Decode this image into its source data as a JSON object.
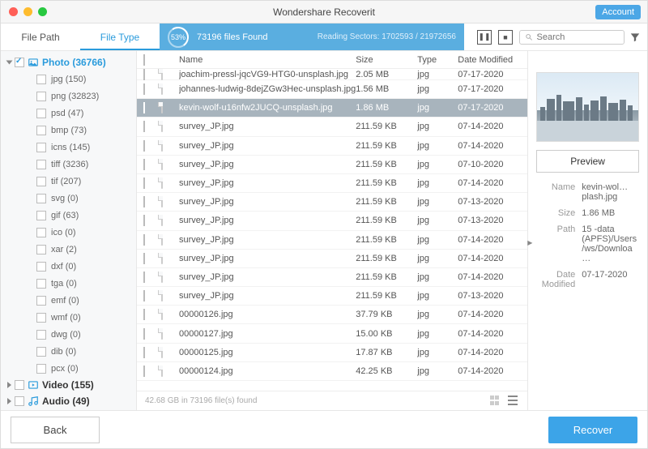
{
  "app": {
    "title": "Wondershare Recoverit",
    "account_label": "Account"
  },
  "viewTabs": {
    "filePath": "File Path",
    "fileType": "File Type"
  },
  "progress": {
    "percent": "53%",
    "found": "73196 files Found",
    "sectors": "Reading Sectors: 1702593 / 21972656"
  },
  "search": {
    "placeholder": "Search"
  },
  "sidebar": {
    "categories": [
      {
        "label": "Photo (36766)",
        "expanded": true,
        "checked": true,
        "active": true,
        "subs": [
          {
            "label": "jpg (150)"
          },
          {
            "label": "png (32823)"
          },
          {
            "label": "psd (47)"
          },
          {
            "label": "bmp (73)"
          },
          {
            "label": "icns (145)"
          },
          {
            "label": "tiff (3236)"
          },
          {
            "label": "tif (207)"
          },
          {
            "label": "svg (0)"
          },
          {
            "label": "gif (63)"
          },
          {
            "label": "ico (0)"
          },
          {
            "label": "xar (2)"
          },
          {
            "label": "dxf (0)"
          },
          {
            "label": "tga (0)"
          },
          {
            "label": "emf (0)"
          },
          {
            "label": "wmf (0)"
          },
          {
            "label": "dwg (0)"
          },
          {
            "label": "dib (0)"
          },
          {
            "label": "pcx (0)"
          }
        ]
      },
      {
        "label": "Video (155)",
        "expanded": false
      },
      {
        "label": "Audio (49)",
        "expanded": false
      }
    ]
  },
  "table": {
    "headers": {
      "name": "Name",
      "size": "Size",
      "type": "Type",
      "date": "Date Modified"
    },
    "rows": [
      {
        "name": "joachim-pressl-jqcVG9-HTG0-unsplash.jpg",
        "size": "2.05 MB",
        "type": "jpg",
        "date": "07-17-2020",
        "sel": false,
        "cut": true
      },
      {
        "name": "johannes-ludwig-8dejZGw3Hec-unsplash.jpg",
        "size": "1.56 MB",
        "type": "jpg",
        "date": "07-17-2020",
        "sel": false
      },
      {
        "name": "kevin-wolf-u16nfw2JUCQ-unsplash.jpg",
        "size": "1.86 MB",
        "type": "jpg",
        "date": "07-17-2020",
        "sel": true
      },
      {
        "name": "survey_JP.jpg",
        "size": "211.59 KB",
        "type": "jpg",
        "date": "07-14-2020"
      },
      {
        "name": "survey_JP.jpg",
        "size": "211.59 KB",
        "type": "jpg",
        "date": "07-14-2020"
      },
      {
        "name": "survey_JP.jpg",
        "size": "211.59 KB",
        "type": "jpg",
        "date": "07-10-2020"
      },
      {
        "name": "survey_JP.jpg",
        "size": "211.59 KB",
        "type": "jpg",
        "date": "07-14-2020"
      },
      {
        "name": "survey_JP.jpg",
        "size": "211.59 KB",
        "type": "jpg",
        "date": "07-13-2020"
      },
      {
        "name": "survey_JP.jpg",
        "size": "211.59 KB",
        "type": "jpg",
        "date": "07-13-2020"
      },
      {
        "name": "survey_JP.jpg",
        "size": "211.59 KB",
        "type": "jpg",
        "date": "07-14-2020"
      },
      {
        "name": "survey_JP.jpg",
        "size": "211.59 KB",
        "type": "jpg",
        "date": "07-14-2020"
      },
      {
        "name": "survey_JP.jpg",
        "size": "211.59 KB",
        "type": "jpg",
        "date": "07-14-2020"
      },
      {
        "name": "survey_JP.jpg",
        "size": "211.59 KB",
        "type": "jpg",
        "date": "07-13-2020"
      },
      {
        "name": "00000126.jpg",
        "size": "37.79 KB",
        "type": "jpg",
        "date": "07-14-2020"
      },
      {
        "name": "00000127.jpg",
        "size": "15.00 KB",
        "type": "jpg",
        "date": "07-14-2020"
      },
      {
        "name": "00000125.jpg",
        "size": "17.87 KB",
        "type": "jpg",
        "date": "07-14-2020"
      },
      {
        "name": "00000124.jpg",
        "size": "42.25 KB",
        "type": "jpg",
        "date": "07-14-2020"
      }
    ],
    "footer": "42.68 GB in 73196 file(s) found"
  },
  "details": {
    "preview_label": "Preview",
    "fields": {
      "name_k": "Name",
      "name_v": "kevin-wol…plash.jpg",
      "size_k": "Size",
      "size_v": "1.86 MB",
      "path_k": "Path",
      "path_v": "15 -data (APFS)/Users/ws/Downloa…",
      "date_k": "Date Modified",
      "date_v": "07-17-2020"
    }
  },
  "footer": {
    "back": "Back",
    "recover": "Recover"
  }
}
